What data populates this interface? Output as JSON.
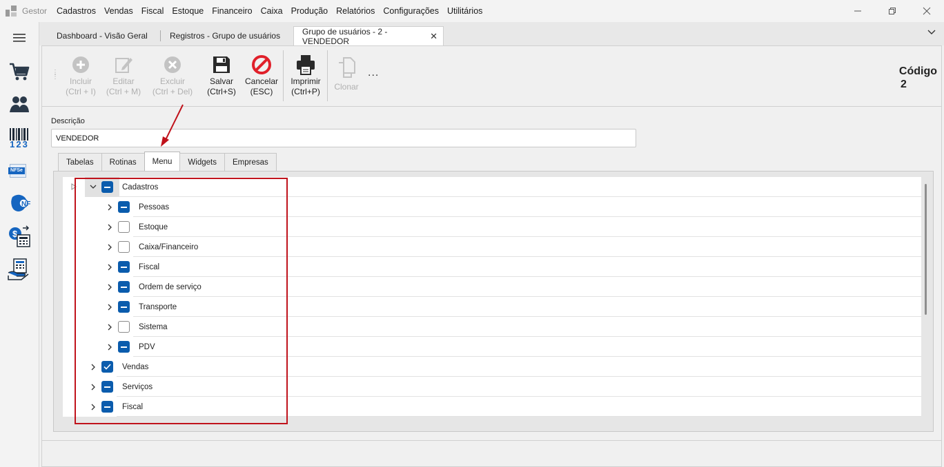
{
  "app": {
    "name": "Gestor"
  },
  "menu": [
    "Cadastros",
    "Vendas",
    "Fiscal",
    "Estoque",
    "Financeiro",
    "Caixa",
    "Produção",
    "Relatórios",
    "Configurações",
    "Utilitários"
  ],
  "tabs": [
    {
      "label": "Dashboard - Visão Geral"
    },
    {
      "label": "Registros - Grupo de usuários"
    },
    {
      "label": "Grupo de usuários - 2 - VENDEDOR"
    }
  ],
  "sidebar": {
    "icons": [
      "cart-icon",
      "users-icon",
      "barcode-icon",
      "nfse-icon",
      "nfe-icon",
      "money-calculator-icon",
      "cash-register-icon"
    ],
    "nfse_text": "NFSe",
    "nfe_text": "NFe",
    "barcode_digits": "123"
  },
  "toolbar": {
    "incluir": {
      "label": "Incluir",
      "shortcut": "(Ctrl + I)"
    },
    "editar": {
      "label": "Editar",
      "shortcut": "(Ctrl + M)"
    },
    "excluir": {
      "label": "Excluir",
      "shortcut": "(Ctrl + Del)"
    },
    "salvar": {
      "label": "Salvar",
      "shortcut": "(Ctrl+S)"
    },
    "cancelar": {
      "label": "Cancelar",
      "shortcut": "(ESC)"
    },
    "imprimir": {
      "label": "Imprimir",
      "shortcut": "(Ctrl+P)"
    },
    "clonar": {
      "label": "Clonar"
    },
    "more": "..."
  },
  "codigo": {
    "label": "Código",
    "value": "2"
  },
  "form": {
    "descricao_label": "Descrição",
    "descricao_value": "VENDEDOR"
  },
  "subtabs": [
    "Tabelas",
    "Rotinas",
    "Menu",
    "Widgets",
    "Empresas"
  ],
  "tree": [
    {
      "label": "Cadastros",
      "level": 0,
      "state": "partial",
      "expanded": true,
      "selected": true
    },
    {
      "label": "Pessoas",
      "level": 1,
      "state": "partial"
    },
    {
      "label": "Estoque",
      "level": 1,
      "state": "unchecked"
    },
    {
      "label": "Caixa/Financeiro",
      "level": 1,
      "state": "unchecked"
    },
    {
      "label": "Fiscal",
      "level": 1,
      "state": "partial"
    },
    {
      "label": "Ordem de serviço",
      "level": 1,
      "state": "partial"
    },
    {
      "label": "Transporte",
      "level": 1,
      "state": "partial"
    },
    {
      "label": "Sistema",
      "level": 1,
      "state": "unchecked"
    },
    {
      "label": "PDV",
      "level": 1,
      "state": "partial"
    },
    {
      "label": "Vendas",
      "level": 0,
      "state": "checked"
    },
    {
      "label": "Serviços",
      "level": 0,
      "state": "partial"
    },
    {
      "label": "Fiscal",
      "level": 0,
      "state": "partial"
    }
  ],
  "colors": {
    "accent": "#0b5cad",
    "annotation": "#c0121b"
  }
}
